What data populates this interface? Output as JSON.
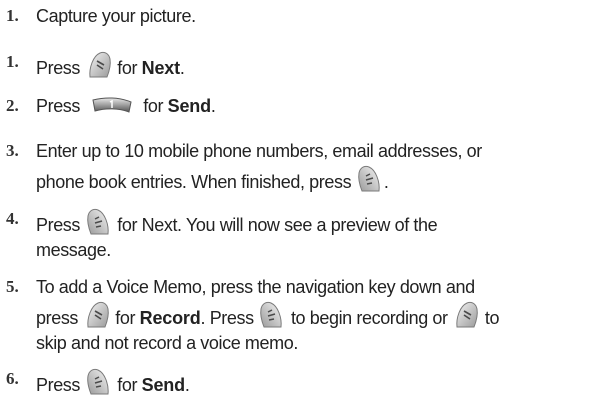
{
  "steps": [
    {
      "number": "1.",
      "parts": [
        "Capture your picture."
      ]
    },
    {
      "number": "1.",
      "parts": [
        "Press",
        "for",
        "Next",
        "."
      ]
    },
    {
      "number": "2.",
      "parts": [
        "Press",
        "for",
        "Send",
        "."
      ]
    },
    {
      "number": "3.",
      "lines": [
        "Enter up to 10 mobile phone numbers, email addresses, or",
        "phone book entries. When finished, press",
        "."
      ]
    },
    {
      "number": "4.",
      "lines": [
        "Press",
        "for Next. You will now see a preview of the",
        "message."
      ]
    },
    {
      "number": "5.",
      "lines": [
        "To add a Voice Memo, press the navigation key down and",
        "press",
        "for",
        "Record",
        ". Press",
        "to begin recording or",
        "to",
        "skip and not record a voice memo."
      ]
    },
    {
      "number": "6.",
      "parts": [
        "Press",
        "for",
        "Send",
        "."
      ]
    }
  ],
  "icons": {
    "left_soft_key": "menu-softkey-icon",
    "send_key": "send-key-1-icon",
    "right_soft_key": "ok-softkey-icon"
  }
}
